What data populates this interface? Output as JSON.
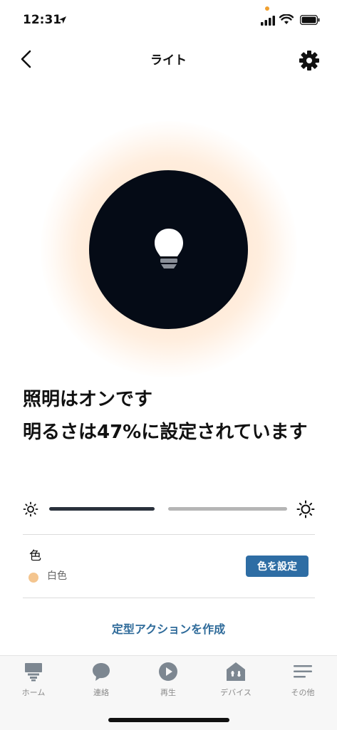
{
  "status_bar": {
    "time": "12:31"
  },
  "nav": {
    "title": "ライト"
  },
  "device": {
    "status_line1": "照明はオンです",
    "status_line2": "明るさは47%に設定されています",
    "brightness_percent": 47
  },
  "color": {
    "label": "色",
    "current_value": "白色",
    "swatch_color": "#f4c58f",
    "set_button": "色を設定"
  },
  "routine_link": "定型アクションを作成",
  "tabs": [
    {
      "label": "ホーム",
      "icon": "home-icon"
    },
    {
      "label": "連絡",
      "icon": "chat-bubble-icon"
    },
    {
      "label": "再生",
      "icon": "play-icon"
    },
    {
      "label": "デバイス",
      "icon": "devices-icon"
    },
    {
      "label": "その他",
      "icon": "menu-icon"
    }
  ],
  "colors": {
    "accent": "#2e6da4",
    "link": "#2f6b9a",
    "power_circle": "#050b16",
    "glow": "#ffc48c"
  }
}
